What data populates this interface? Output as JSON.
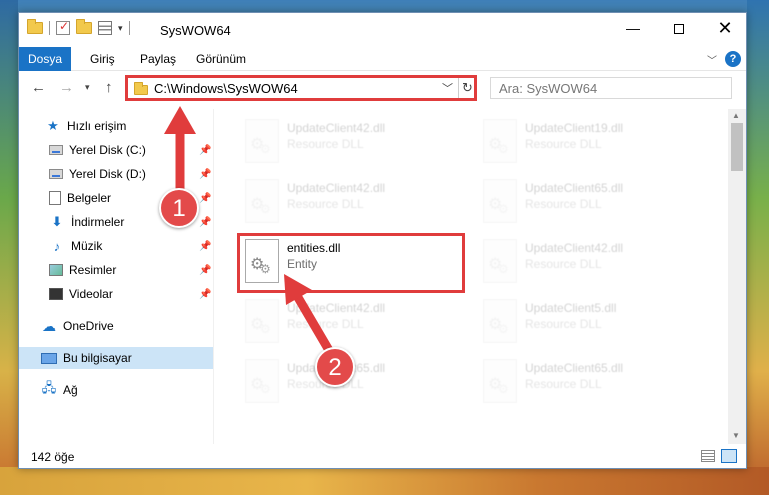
{
  "window": {
    "title": "SysWOW64"
  },
  "ribbon": {
    "tabs": [
      "Dosya",
      "Giriş",
      "Paylaş",
      "Görünüm"
    ]
  },
  "address": {
    "path": "C:\\Windows\\SysWOW64"
  },
  "search": {
    "placeholder": "Ara: SysWOW64"
  },
  "sidebar": {
    "items": [
      {
        "label": "Hızlı erişim",
        "icon": "star-icon"
      },
      {
        "label": "Yerel Disk (C:)",
        "icon": "drive-icon",
        "pinned": true
      },
      {
        "label": "Yerel Disk (D:)",
        "icon": "drive-icon",
        "pinned": true
      },
      {
        "label": "Belgeler",
        "icon": "documents-icon",
        "pinned": true
      },
      {
        "label": "İndirmeler",
        "icon": "download-icon",
        "pinned": true
      },
      {
        "label": "Müzik",
        "icon": "music-icon",
        "pinned": true
      },
      {
        "label": "Resimler",
        "icon": "pictures-icon",
        "pinned": true
      },
      {
        "label": "Videolar",
        "icon": "videos-icon",
        "pinned": true
      },
      {
        "label": "OneDrive",
        "icon": "cloud-icon"
      },
      {
        "label": "Bu bilgisayar",
        "icon": "computer-icon",
        "selected": true
      },
      {
        "label": "Ağ",
        "icon": "network-icon"
      }
    ]
  },
  "files": [
    {
      "name": "UpdateClient42.dll",
      "type": "Resource DLL"
    },
    {
      "name": "UpdateClient19.dll",
      "type": "Resource DLL"
    },
    {
      "name": "UpdateClient42.dll",
      "type": "Resource DLL"
    },
    {
      "name": "UpdateClient65.dll",
      "type": "Resource DLL"
    },
    {
      "name": "entities.dll",
      "type": "Entity"
    },
    {
      "name": "UpdateClient42.dll",
      "type": "Resource DLL"
    },
    {
      "name": "UpdateClient42.dll",
      "type": "Resource DLL"
    },
    {
      "name": "UpdateClient5.dll",
      "type": "Resource DLL"
    },
    {
      "name": "UpdateClient65.dll",
      "type": "Resource DLL"
    },
    {
      "name": "UpdateClient65.dll",
      "type": "Resource DLL"
    }
  ],
  "status": {
    "count": "142 öğe"
  },
  "annotations": {
    "step1": "1",
    "step2": "2",
    "color": "#e03c3c"
  }
}
